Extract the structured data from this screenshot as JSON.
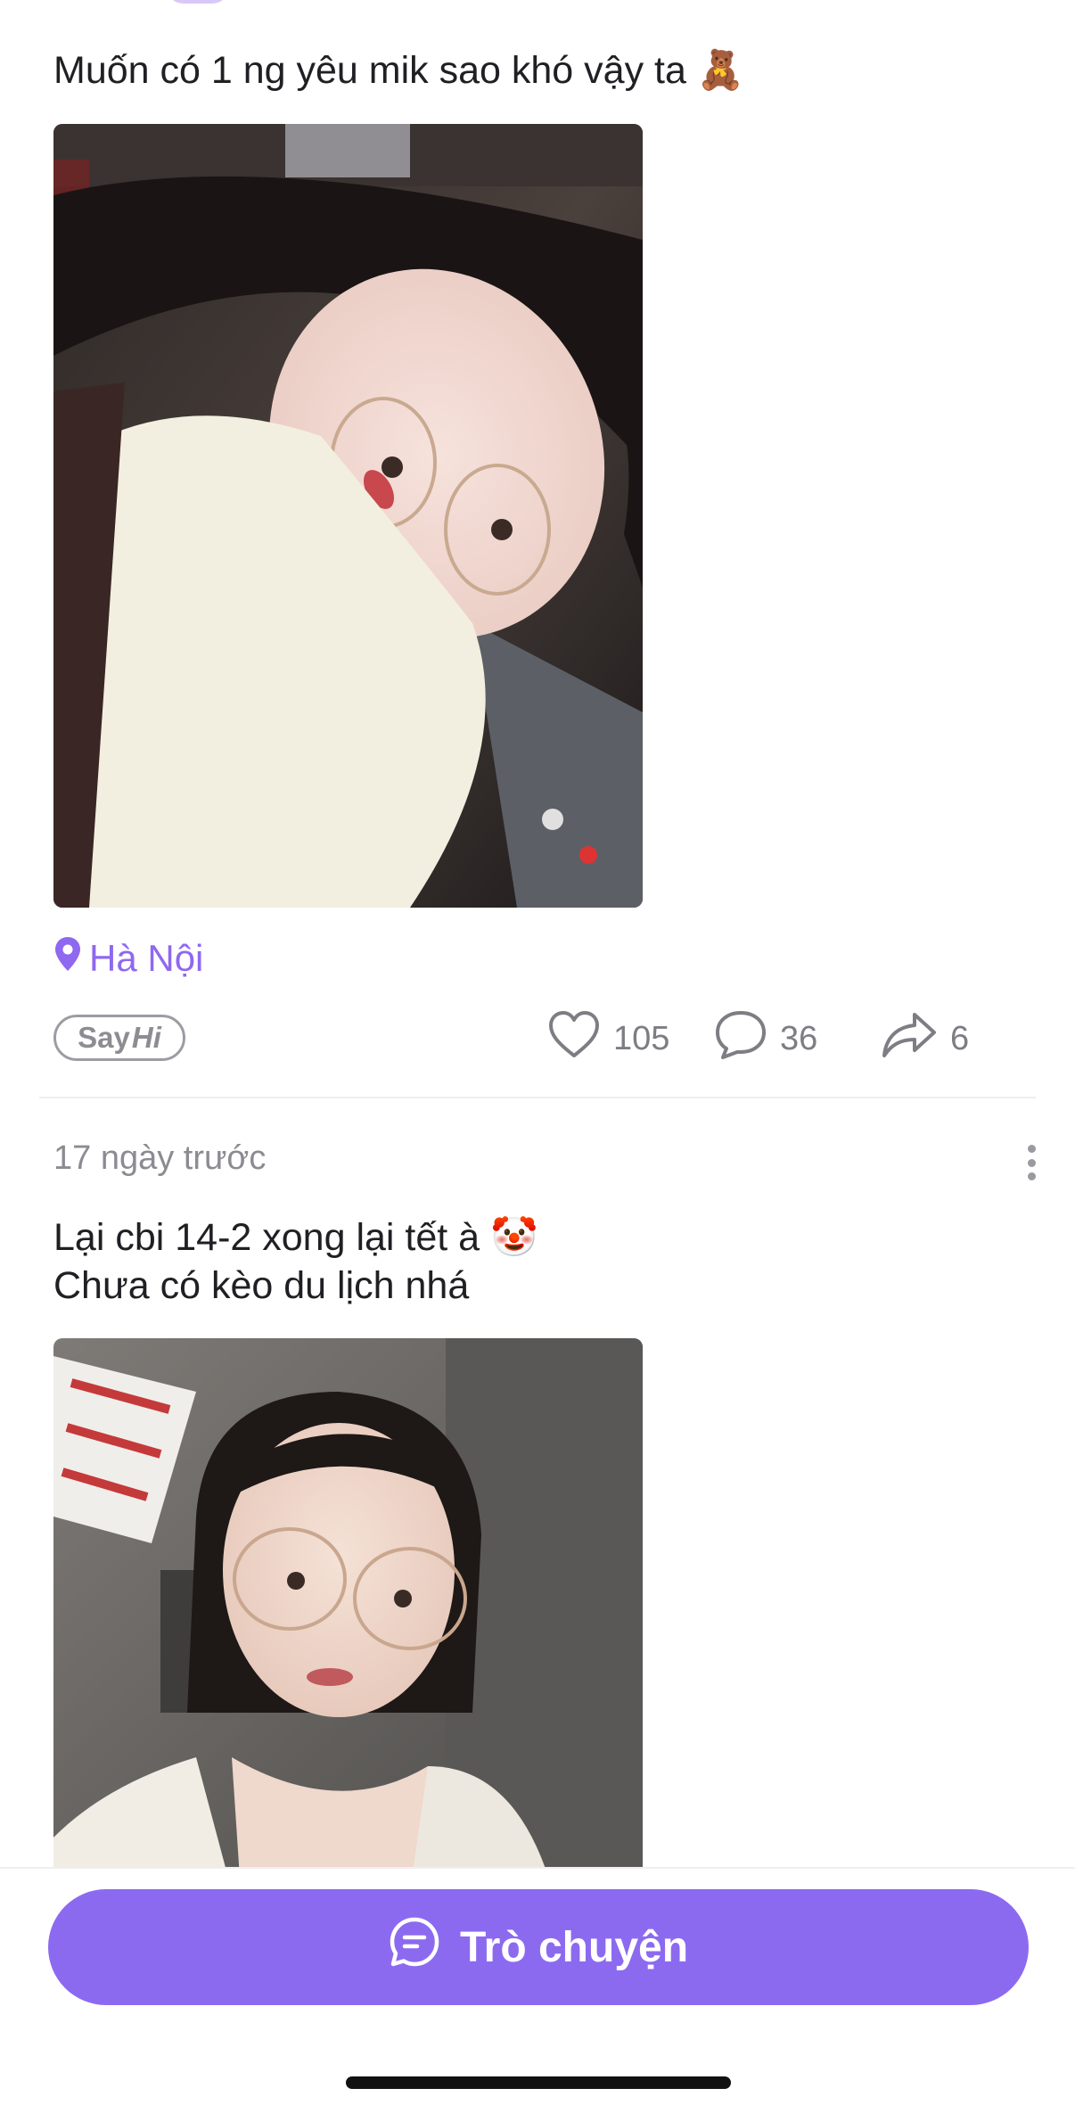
{
  "posts": [
    {
      "text": "Muốn có 1 ng yêu mik sao khó vậy ta 🧸",
      "photo_description": "selfie-girl-glasses-white-scarf",
      "location": "Hà Nội",
      "say_hi": {
        "say": "Say",
        "hi": "Hi"
      },
      "likes": "105",
      "comments": "36",
      "shares": "6"
    },
    {
      "timestamp": "17 ngày trước",
      "text": "Lại cbi 14-2 xong lại tết à 🤡\nChưa có kèo du lịch nhá",
      "photo_description": "selfie-girl-glasses-white-jacket"
    }
  ],
  "bottom": {
    "chat_button_label": "Trò chuyện"
  },
  "colors": {
    "accent": "#8c6af0",
    "location": "#8f68f0",
    "muted_text": "#8b8b92"
  },
  "icons": [
    "location-pin-icon",
    "heart-icon",
    "comment-icon",
    "share-icon",
    "more-vertical-icon",
    "chat-bubble-icon"
  ]
}
